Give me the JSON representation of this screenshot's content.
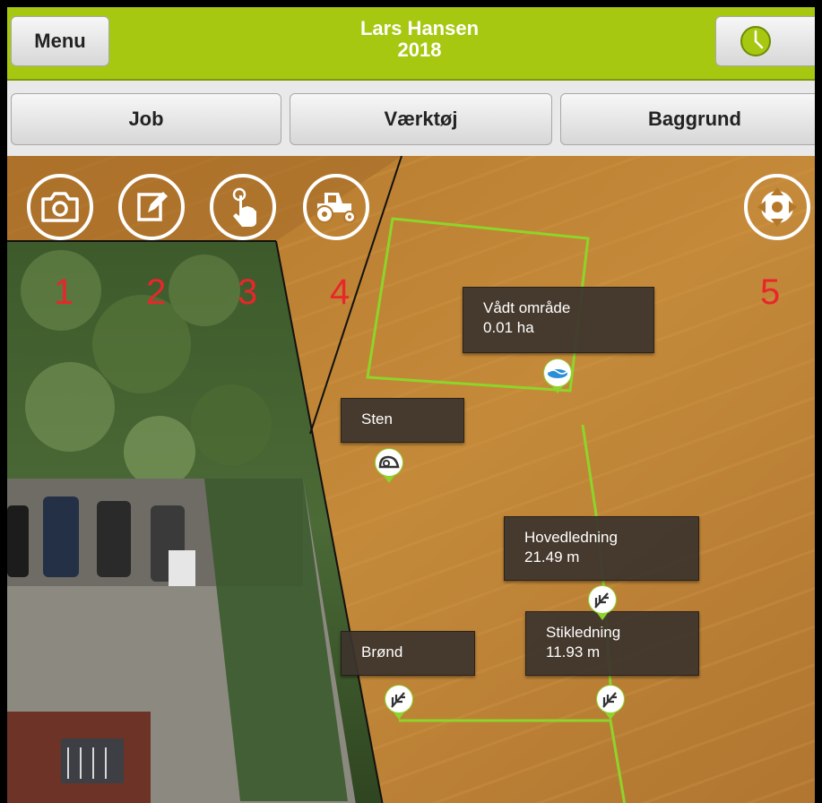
{
  "header": {
    "menu_label": "Menu",
    "user_name": "Lars Hansen",
    "year": "2018",
    "clock_icon": "clock-icon"
  },
  "tabs": [
    {
      "label": "Job"
    },
    {
      "label": "Værktøj"
    },
    {
      "label": "Baggrund"
    }
  ],
  "map": {
    "tools": [
      {
        "icon": "camera-icon",
        "number": "1"
      },
      {
        "icon": "edit-note-icon",
        "number": "2"
      },
      {
        "icon": "touch-hand-icon",
        "number": "3"
      },
      {
        "icon": "tractor-icon",
        "number": "4"
      },
      {
        "icon": "locate-crosshair-icon",
        "number": "5"
      }
    ],
    "labels": {
      "vadt_omrade": {
        "name": "Vådt område",
        "value": "0.01 ha"
      },
      "sten": {
        "name": "Sten"
      },
      "hovedledning": {
        "name": "Hovedledning",
        "value": "21.49 m"
      },
      "stikledning": {
        "name": "Stikledning",
        "value": "11.93 m"
      },
      "brond": {
        "name": "Brønd"
      }
    },
    "colors": {
      "header_green": "#a6c811",
      "line_green": "#8ed42a",
      "number_red": "#e8262b"
    }
  }
}
